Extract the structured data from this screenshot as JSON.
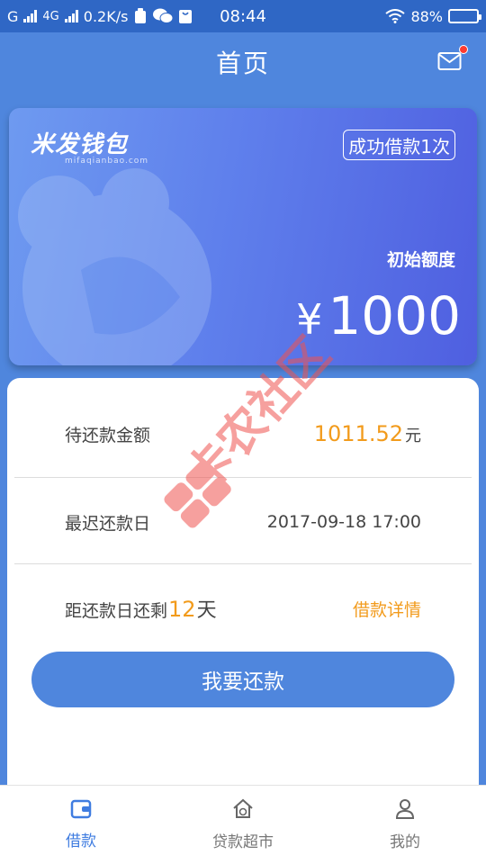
{
  "status_bar": {
    "carrier_1": "G",
    "network": "4G",
    "speed": "0.2K/s",
    "time": "08:44",
    "battery": "88%",
    "battery_level": 0.88
  },
  "header": {
    "title": "首页"
  },
  "card": {
    "brand": "米发钱包",
    "brand_sub": "mifaqianbao.com",
    "badge": "成功借款1次",
    "limit_label": "初始额度",
    "currency": "¥",
    "limit_amount": "1000"
  },
  "info": {
    "pending_label": "待还款金额",
    "pending_amount": "1011.52",
    "pending_unit": "元",
    "due_label": "最迟还款日",
    "due_date": "2017-09-18 17:00",
    "remain_prefix": "距还款日还剩",
    "remain_days": "12",
    "remain_suffix": "天",
    "detail_link": "借款详情"
  },
  "repay_button": "我要还款",
  "watermark": "卡农社区",
  "bottom_nav": [
    {
      "label": "借款",
      "icon": "wallet-icon",
      "active": true
    },
    {
      "label": "贷款超市",
      "icon": "store-icon",
      "active": false
    },
    {
      "label": "我的",
      "icon": "user-icon",
      "active": false
    }
  ],
  "colors": {
    "primary": "#4f86dd",
    "accent": "#f29b1c",
    "status_bar": "#2f67c5",
    "watermark": "#ef5350"
  }
}
